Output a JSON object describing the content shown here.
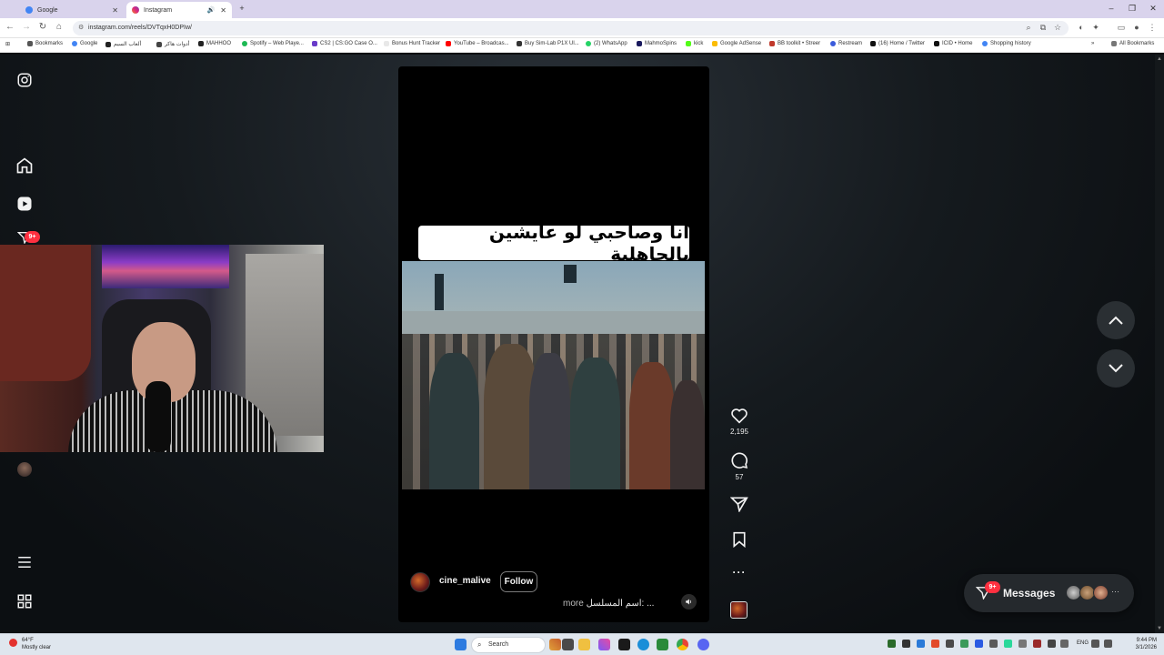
{
  "browser": {
    "tabs": [
      {
        "label": "Google",
        "active": false
      },
      {
        "label": "Instagram",
        "active": true
      }
    ],
    "new_tab": "+",
    "window_controls": {
      "minimize": "–",
      "restore": "❐",
      "close": "✕"
    },
    "url": "instagram.com/reels/DVTqxH0DPIw/",
    "bookmarks": [
      "Bookmarks",
      "Google",
      "ألعاب السيم",
      "أدوات هاكر",
      "MAHHOO",
      "Spotify – Web Playe...",
      "CS2 | CS:GO Case O...",
      "Bonus Hunt Tracker",
      "YouTube – Broadcas...",
      "Buy Sim-Lab P1X Ul...",
      "(2) WhatsApp",
      "MahmoSpins",
      "kick",
      "Google AdSense",
      "BB toolkit • Streer",
      "Restream",
      "(16) Home / Twitter",
      "ICID • Home",
      "Shopping history"
    ],
    "all_bookmarks": "All Bookmarks"
  },
  "sidebar": {
    "notification_badge": "9+"
  },
  "reel": {
    "caption_overlay": "انا وصاحبي لو عايشين بالجاهلية",
    "username": "cine_malive",
    "follow_label": "Follow",
    "description": "اسم المسلسل: ...",
    "more_label": "more",
    "likes": "2,195",
    "comments": "57",
    "more_dots": "···"
  },
  "messages": {
    "label": "Messages",
    "badge": "9+",
    "more_dots": "···"
  },
  "taskbar": {
    "weather_temp": "64°F",
    "weather_desc": "Mostly clear",
    "search_label": "Search",
    "lang": "ENG",
    "time": "9:44 PM",
    "date": "3/1/2026"
  },
  "colors": {
    "accent_badge": "#ff3040",
    "page_bg": "#0c0f12",
    "tab_strip": "#d9d3ec"
  },
  "icons": [
    "instagram-logo-icon",
    "home-icon",
    "reels-icon",
    "heart-icon",
    "comment-icon",
    "share-icon",
    "bookmark-icon",
    "chevron-up-icon",
    "chevron-down-icon",
    "menu-icon",
    "more-apps-icon",
    "volume-icon",
    "messages-icon"
  ]
}
